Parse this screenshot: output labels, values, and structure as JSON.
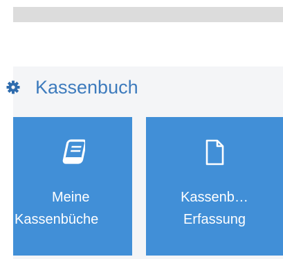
{
  "top_bar": {},
  "section": {
    "title": "Kassenbuch",
    "icon": "gear-icon",
    "accent_color": "#3d7bbd"
  },
  "tiles": [
    {
      "icon": "book-icon",
      "label_line1": "Meine",
      "label_line2": "Kassenbüche",
      "color": "#418fd7"
    },
    {
      "icon": "document-icon",
      "label_line1": "Kassenb…",
      "label_line2": "Erfassung",
      "color": "#418fd7"
    }
  ]
}
